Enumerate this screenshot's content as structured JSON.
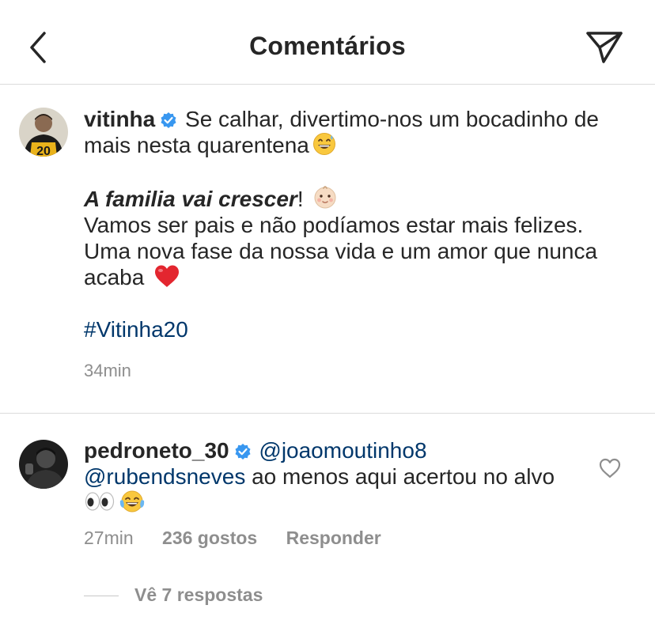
{
  "header": {
    "title": "Comentários",
    "back_icon": "chevron-left-icon",
    "send_icon": "paper-plane-icon"
  },
  "post": {
    "username": "vitinha",
    "verified": true,
    "caption_line1": "Se calhar, divertimo-nos um bocadinho de mais nesta quarentena",
    "bold_phrase": "A familia vai crescer",
    "bold_suffix": "!",
    "line2": "Vamos ser pais e não podíamos estar mais felizes. Uma nova fase da nossa vida e um amor que nunca acaba",
    "hashtag": "#Vitinha20",
    "time": "34min",
    "jersey_number": "20"
  },
  "comment": {
    "username": "pedroneto_30",
    "verified": true,
    "mention1": "@joaomoutinho8",
    "mention2": "@rubendsneves",
    "text": "ao menos aqui acertou no alvo",
    "time": "27min",
    "likes": "236 gostos",
    "reply_label": "Responder",
    "view_replies": "Vê 7 respostas"
  },
  "colors": {
    "text": "#262626",
    "secondary": "#8e8e8e",
    "link": "#00376b",
    "verified": "#3897f0",
    "divider": "#dbdbdb"
  }
}
